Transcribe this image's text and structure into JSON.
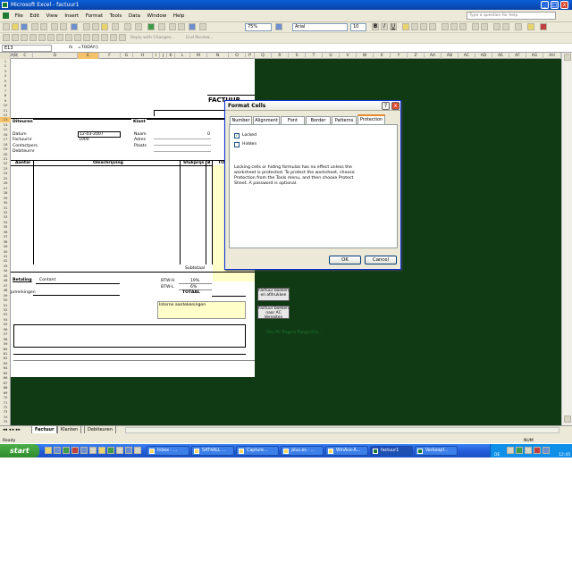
{
  "window": {
    "title": "Microsoft Excel - factuur1",
    "min": "_",
    "max": "□",
    "close": "x"
  },
  "menu": {
    "items": [
      "File",
      "Edit",
      "View",
      "Insert",
      "Format",
      "Tools",
      "Data",
      "Window",
      "Help"
    ],
    "help_placeholder": "Type a question for help"
  },
  "toolbar": {
    "zoom": "75%",
    "font": "Arial",
    "size": "10",
    "bold": "B",
    "italic": "I",
    "underline": "U",
    "reply_changes": "Reply with Changes...",
    "end_review": "End Review..."
  },
  "formula_bar": {
    "cell_ref": "E13",
    "fx": "fx",
    "formula": "=TODAY()"
  },
  "columns": [
    "A",
    "B",
    "C",
    "D",
    "E",
    "F",
    "G",
    "H",
    "I",
    "J",
    "K",
    "L",
    "M",
    "N",
    "O",
    "P",
    "Q",
    "R",
    "S",
    "T",
    "U",
    "V",
    "W",
    "X",
    "Y",
    "Z",
    "AA",
    "AB",
    "AC",
    "AD",
    "AE",
    "AF",
    "AG",
    "AH"
  ],
  "rows": [
    "1",
    "2",
    "3",
    "4",
    "5",
    "6",
    "7",
    "8",
    "9",
    "10",
    "11",
    "12",
    "13",
    "14",
    "15",
    "16",
    "17",
    "18",
    "19",
    "20",
    "21",
    "22",
    "23",
    "24",
    "25",
    "26",
    "27",
    "28",
    "29",
    "30",
    "31",
    "32",
    "33",
    "34",
    "35",
    "36",
    "37",
    "38",
    "39",
    "40",
    "41",
    "42",
    "43",
    "44",
    "45",
    "46",
    "47",
    "48",
    "49",
    "50",
    "51",
    "52",
    "53",
    "54",
    "55",
    "56",
    "57",
    "58",
    "59",
    "60",
    "61",
    "62",
    "63",
    "64",
    "65",
    "66",
    "67",
    "68",
    "69",
    "70",
    "71",
    "72",
    "73",
    "74",
    "75"
  ],
  "invoice": {
    "header": "FACTUUR",
    "debiteur": "Diteuren",
    "klant": "Klant",
    "datum_label": "Datum",
    "datum_value": "12-03-2007",
    "factuurnr_label": "Factuurnr",
    "factuurnr_value": "1000",
    "contactpers_label": "Contactpers.",
    "debiteurnr_label": "Debiteurnr",
    "naam_label": "Naam",
    "naam_value": "0",
    "adres_label": "Adres",
    "plaats_label": "Plaats",
    "col_aantal": "Aantal",
    "col_omschrijving": "Omschrijving",
    "col_stukprijs": "Stukprijs",
    "col_btw": "B",
    "col_totaal": "TO",
    "subtotaal": "Subtotaal",
    "betaling": "Betaling",
    "betaling_value": "Contant",
    "opmerkingen": "pmerkingen",
    "btw_h": "BTW-H",
    "btw_h_pct": "19%",
    "btw_l": "BTW-L",
    "btw_l_pct": "6%",
    "totaal": "TOTAAL",
    "interne": "Interne aantekeningen"
  },
  "sheet_buttons": {
    "afdrukken": "Factuur boeken en afdrukken",
    "pdf": "Factuur boeken naar AC Vereisten",
    "note": "Stel PC Pagina Rangschik..."
  },
  "dialog": {
    "title": "Format Cells",
    "help": "?",
    "close": "x",
    "tabs": [
      "Number",
      "Alignment",
      "Font",
      "Border",
      "Patterns",
      "Protection"
    ],
    "active_tab": "Protection",
    "locked_label": "Locked",
    "locked_checked": true,
    "hidden_label": "Hidden",
    "hidden_checked": false,
    "description": "Locking cells or hiding formulas has no effect unless the worksheet is protected. To protect the worksheet, choose Protection from the Tools menu, and then choose Protect Sheet. A password is optional.",
    "ok": "OK",
    "cancel": "Cancel"
  },
  "sheet_tabs": [
    "Factuur",
    "Klanten",
    "Debiteuren"
  ],
  "status": {
    "left": "Ready",
    "right": "NUM"
  },
  "taskbar": {
    "start": "start",
    "tasks": [
      "Inbox - ...",
      "SAT4ALL ...",
      "Capture...",
      "plus.es - ...",
      "WinAce-A...",
      "factuur1",
      "Verkoopf..."
    ],
    "active": "factuur1",
    "lang": "DE",
    "clock": "12:45"
  }
}
